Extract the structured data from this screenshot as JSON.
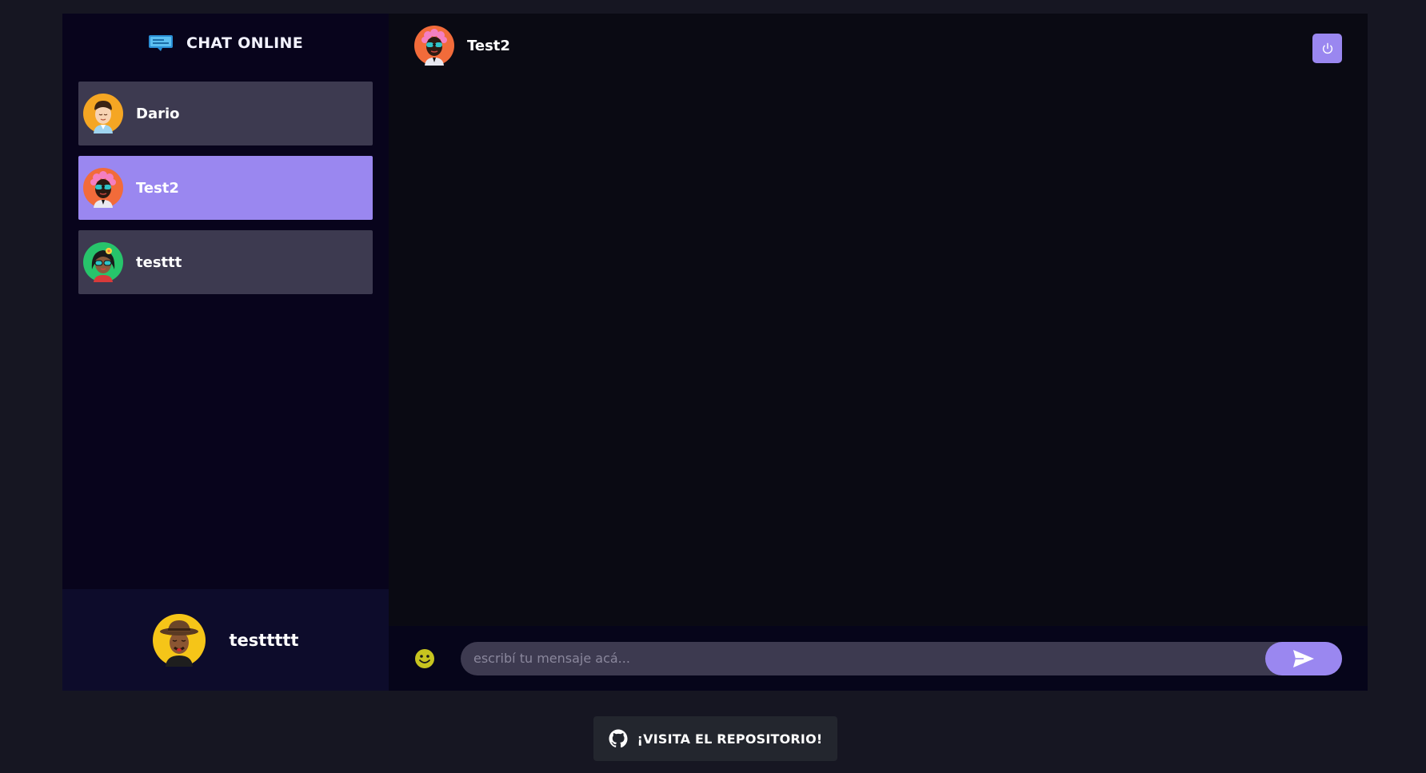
{
  "brand": {
    "title": "CHAT ONLINE",
    "logo_icon": "chat-bubble-icon"
  },
  "contacts": [
    {
      "name": "Dario",
      "avatar": "avatar-dario",
      "active": false
    },
    {
      "name": "Test2",
      "avatar": "avatar-test2",
      "active": true
    },
    {
      "name": "testtt",
      "avatar": "avatar-testtt",
      "active": false
    }
  ],
  "profile": {
    "name": "testtttt",
    "avatar": "avatar-current-user"
  },
  "chat": {
    "header_name": "Test2",
    "power_icon": "power-icon",
    "input_placeholder": "escribí tu mensaje acá...",
    "emoji_icon": "smiley-icon",
    "send_icon": "send-icon"
  },
  "footer": {
    "repo_label": "¡VISITA EL REPOSITORIO!",
    "repo_icon": "github-icon"
  },
  "colors": {
    "accent": "#9a87f0",
    "sidebar_bg": "#08041c",
    "contact_bg": "#3d3a50",
    "page_bg": "#161622",
    "chat_bg": "#0a0a13"
  }
}
